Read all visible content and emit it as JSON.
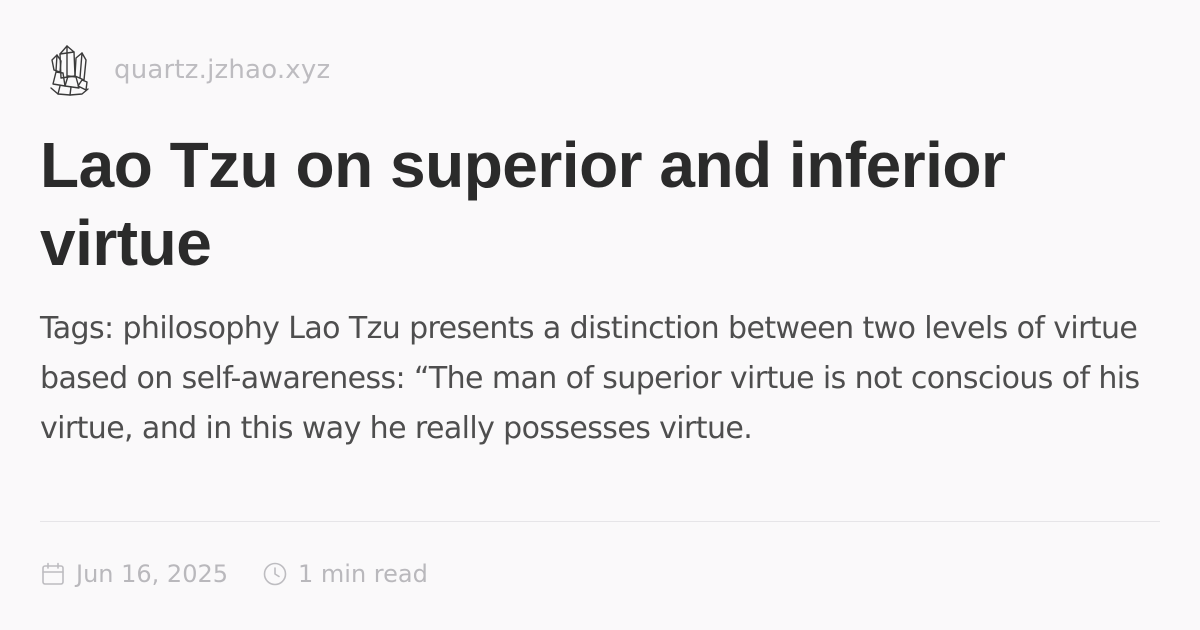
{
  "site": {
    "domain": "quartz.jzhao.xyz",
    "logo_icon": "crystal-cluster-icon"
  },
  "article": {
    "title": "Lao Tzu on superior and inferior virtue",
    "description": "Tags: philosophy Lao Tzu presents a distinction between two levels of virtue based on self-awareness: “The man of superior virtue is not conscious of his virtue, and in this way he really possesses virtue.",
    "date": "Jun 16, 2025",
    "date_icon": "calendar-icon",
    "reading_time": "1 min read",
    "reading_time_icon": "clock-icon"
  },
  "colors": {
    "background": "#faf9fa",
    "title": "#2b2b2b",
    "description": "#4e4e4e",
    "muted": "#b9b8bc",
    "divider": "#e6e5e8"
  }
}
